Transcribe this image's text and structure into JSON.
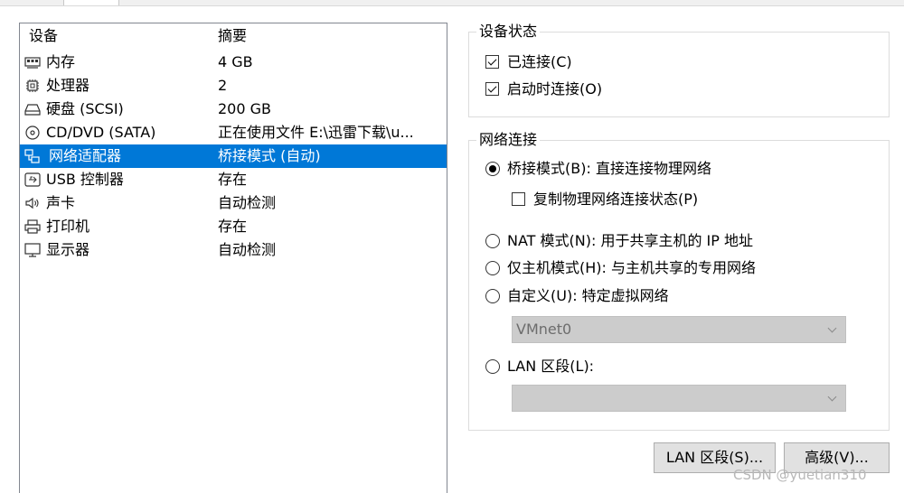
{
  "device_list": {
    "headers": {
      "device": "设备",
      "summary": "摘要"
    },
    "rows": [
      {
        "icon": "memory-icon",
        "name": "内存",
        "summary": "4 GB"
      },
      {
        "icon": "processor-icon",
        "name": "处理器",
        "summary": "2"
      },
      {
        "icon": "hard-disk-icon",
        "name": "硬盘 (SCSI)",
        "summary": "200 GB"
      },
      {
        "icon": "cd-dvd-icon",
        "name": "CD/DVD (SATA)",
        "summary": "正在使用文件 E:\\迅雷下载\\u..."
      },
      {
        "icon": "network-adapter-icon",
        "name": "网络适配器",
        "summary": "桥接模式 (自动)"
      },
      {
        "icon": "usb-icon",
        "name": "USB 控制器",
        "summary": "存在"
      },
      {
        "icon": "sound-card-icon",
        "name": "声卡",
        "summary": "自动检测"
      },
      {
        "icon": "printer-icon",
        "name": "打印机",
        "summary": "存在"
      },
      {
        "icon": "display-icon",
        "name": "显示器",
        "summary": "自动检测"
      }
    ],
    "selected_index": 4
  },
  "device_status": {
    "title": "设备状态",
    "connected": {
      "label": "已连接(C)",
      "checked": true
    },
    "connect_at_power_on": {
      "label": "启动时连接(O)",
      "checked": true
    }
  },
  "network_connection": {
    "title": "网络连接",
    "bridged": {
      "label": "桥接模式(B): 直接连接物理网络",
      "selected": true
    },
    "replicate_state": {
      "label": "复制物理网络连接状态(P)",
      "checked": false
    },
    "nat": {
      "label": "NAT 模式(N): 用于共享主机的 IP 地址",
      "selected": false
    },
    "host_only": {
      "label": "仅主机模式(H): 与主机共享的专用网络",
      "selected": false
    },
    "custom": {
      "label": "自定义(U): 特定虚拟网络",
      "selected": false
    },
    "custom_select_value": "VMnet0",
    "lan_segment": {
      "label": "LAN 区段(L):",
      "selected": false
    },
    "lan_segment_select_value": ""
  },
  "buttons": {
    "lan_segments": "LAN 区段(S)...",
    "advanced": "高级(V)..."
  },
  "watermark": "CSDN @yuetian310",
  "colors": {
    "selection": "#0078d7",
    "disabled_select": "#cccccc"
  }
}
